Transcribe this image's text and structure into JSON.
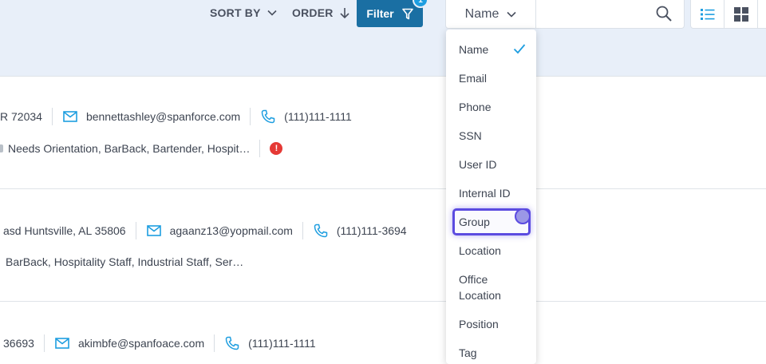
{
  "toolbar": {
    "sort_label": "SORT BY",
    "order_label": "ORDER",
    "filter_label": "Filter",
    "filter_badge": "1"
  },
  "search": {
    "field_selected": "Name",
    "value": "",
    "placeholder": ""
  },
  "rows": [
    {
      "address": "R 72034",
      "email": "bennettashley@spanforce.com",
      "phone": "(111)111-1111",
      "groups": "Needs Orientation, BarBack, Bartender, Hospit…",
      "warning": "!"
    },
    {
      "address": "asd Huntsville, AL 35806",
      "email": "agaanz13@yopmail.com",
      "phone": "(111)111-3694",
      "groups": "BarBack, Hospitality Staff, Industrial Staff, Ser…"
    },
    {
      "address": "36693",
      "email": "akimbfe@spanfoace.com",
      "phone": "(111)111-1111"
    }
  ],
  "dropdown": {
    "selected": "Name",
    "options": [
      "Name",
      "Email",
      "Phone",
      "SSN",
      "User ID",
      "Internal ID",
      "Group",
      "Location",
      "Office",
      "Location",
      "Position",
      "Tag"
    ]
  },
  "colors": {
    "accent": "#1a6fa3",
    "icon_blue": "#1e9ee0",
    "warning": "#e53935",
    "focus": "#5b4be0"
  }
}
